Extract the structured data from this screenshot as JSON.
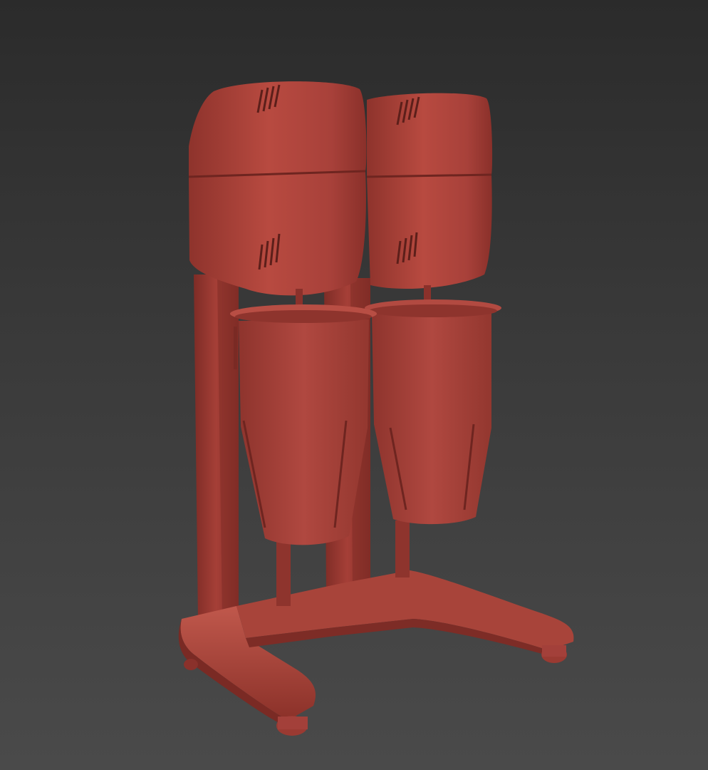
{
  "viewport": {
    "background_top": "#2b2b2b",
    "background_bottom": "#4a4a4a"
  },
  "model": {
    "subject": "twin-spindle-drink-mixer",
    "material_color": "#b5473e",
    "shadow_color": "#7a2a24",
    "highlight_color": "#cf6a5f",
    "unit_count": 2
  }
}
